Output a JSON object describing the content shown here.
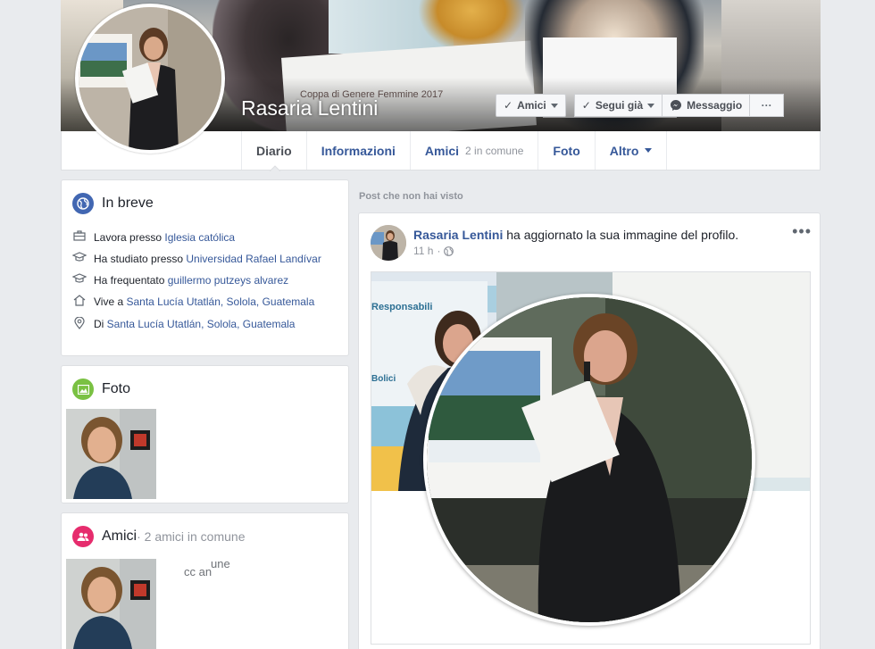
{
  "profile": {
    "name": "Rasaria Lentini",
    "cover_text": "Coppa di Genere Femmine 2017"
  },
  "cover_actions": {
    "friends_label": "Amici",
    "following_label": "Segui già",
    "message_label": "Messaggio",
    "more_label": "···"
  },
  "tabs": [
    {
      "label": "Diario",
      "active": true
    },
    {
      "label": "Informazioni"
    },
    {
      "label": "Amici",
      "sub": "2 in comune"
    },
    {
      "label": "Foto"
    },
    {
      "label": "Altro"
    }
  ],
  "intro": {
    "title": "In breve",
    "rows": [
      {
        "prefix": "Lavora presso ",
        "link": "Iglesia católica",
        "icon": "briefcase-icon"
      },
      {
        "prefix": "Ha studiato presso ",
        "link": "Universidad Rafael Landívar",
        "icon": "graduation-cap-icon"
      },
      {
        "prefix": "Ha frequentato ",
        "link": "guillermo putzeys alvarez",
        "icon": "graduation-cap-icon"
      },
      {
        "prefix": "Vive a ",
        "link": "Santa Lucía Utatlán, Solola, Guatemala",
        "icon": "home-icon"
      },
      {
        "prefix": "Di ",
        "link": "Santa Lucía Utatlán, Solola, Guatemala",
        "icon": "location-pin-icon"
      }
    ]
  },
  "photos": {
    "title": "Foto"
  },
  "friends": {
    "title": "Amici",
    "sub": " · 2 amici in comune",
    "overlay_text": "cc an",
    "overlay_text2": "une"
  },
  "feed": {
    "label": "Post che non hai visto"
  },
  "post": {
    "author": "Rasaria Lentini",
    "action": " ha aggiornato la sua immagine del profilo.",
    "time": "11 h",
    "separator": "·",
    "more": "•••",
    "image_banner": "Responsabili",
    "image_banner2": "Bolici"
  },
  "colors": {
    "link": "#365899",
    "background": "#e9ebee",
    "intro_icon": "#4267b2",
    "photos_icon": "#7ac143",
    "friends_icon": "#e62c6d"
  }
}
